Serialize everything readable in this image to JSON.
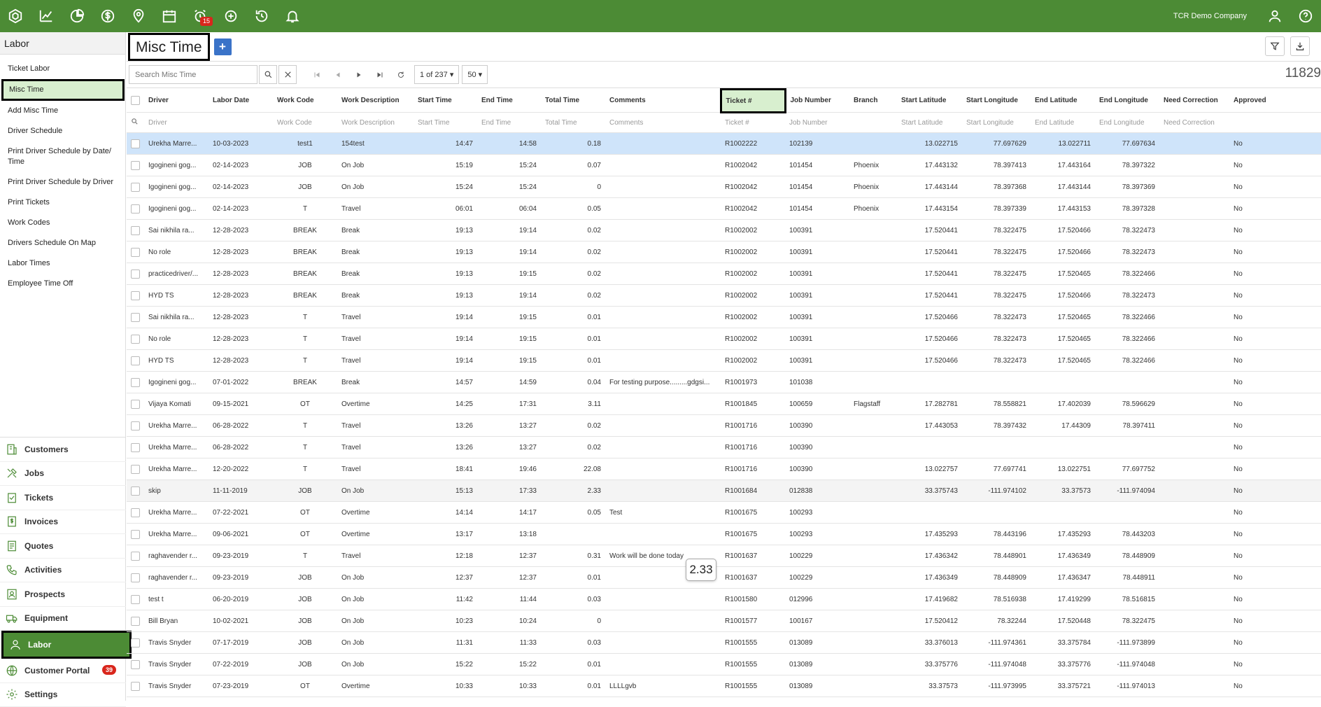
{
  "topbar": {
    "company": "TCR Demo Company",
    "alarm_badge": "15",
    "icons": [
      "logo-icon",
      "analytics-icon",
      "pie-chart-icon",
      "dollar-icon",
      "map-pin-icon",
      "calendar-icon",
      "alarm-clock-icon",
      "add-circle-icon",
      "history-icon",
      "bell-icon"
    ]
  },
  "sidebar": {
    "title": "Labor",
    "items": [
      "Ticket Labor",
      "Misc Time",
      "Add Misc Time",
      "Driver Schedule",
      "Print Driver Schedule by Date/ Time",
      "Print Driver Schedule by Driver",
      "Print Tickets",
      "Work Codes",
      "Drivers Schedule On Map",
      "Labor Times",
      "Employee Time Off"
    ],
    "modules": [
      "Customers",
      "Jobs",
      "Tickets",
      "Invoices",
      "Quotes",
      "Activities",
      "Prospects",
      "Equipment",
      "Labor",
      "Customer Portal",
      "Settings"
    ],
    "portal_badge": "39"
  },
  "page": {
    "title": "Misc Time",
    "add_label": "+",
    "search_placeholder": "Search Misc Time",
    "page_of": "1 of 237 ▾",
    "page_size": "50 ▾",
    "total": "11829",
    "tooltip": "2.33"
  },
  "table": {
    "columns": [
      "Driver",
      "Labor Date",
      "Work Code",
      "Work Description",
      "Start Time",
      "End Time",
      "Total Time",
      "Comments",
      "Ticket #",
      "Job Number",
      "Branch",
      "Start Latitude",
      "Start Longitude",
      "End Latitude",
      "End Longitude",
      "Need Correction",
      "Approved"
    ],
    "filters": [
      "Driver",
      "",
      "Work Code",
      "Work Description",
      "Start Time",
      "End Time",
      "Total Time",
      "Comments",
      "Ticket #",
      "Job Number",
      "",
      "Start Latitude",
      "Start Longitude",
      "End Latitude",
      "End Longitude",
      "Need Correction",
      ""
    ],
    "rows": [
      [
        "Urekha Marre...",
        "10-03-2023",
        "test1",
        "154test",
        "14:47",
        "14:58",
        "0.18",
        "",
        "R1002222",
        "102139",
        "",
        "13.022715",
        "77.697629",
        "13.022711",
        "77.697634",
        "",
        "No"
      ],
      [
        "Igogineni gog...",
        "02-14-2023",
        "JOB",
        "On Job",
        "15:19",
        "15:24",
        "0.07",
        "",
        "R1002042",
        "101454",
        "Phoenix",
        "17.443132",
        "78.397413",
        "17.443164",
        "78.397322",
        "",
        "No"
      ],
      [
        "Igogineni gog...",
        "02-14-2023",
        "JOB",
        "On Job",
        "15:24",
        "15:24",
        "0",
        "",
        "R1002042",
        "101454",
        "Phoenix",
        "17.443144",
        "78.397368",
        "17.443144",
        "78.397369",
        "",
        "No"
      ],
      [
        "Igogineni gog...",
        "02-14-2023",
        "T",
        "Travel",
        "06:01",
        "06:04",
        "0.05",
        "",
        "R1002042",
        "101454",
        "Phoenix",
        "17.443154",
        "78.397339",
        "17.443153",
        "78.397328",
        "",
        "No"
      ],
      [
        "Sai nikhila ra...",
        "12-28-2023",
        "BREAK",
        "Break",
        "19:13",
        "19:14",
        "0.02",
        "",
        "R1002002",
        "100391",
        "",
        "17.520441",
        "78.322475",
        "17.520466",
        "78.322473",
        "",
        "No"
      ],
      [
        "No role",
        "12-28-2023",
        "BREAK",
        "Break",
        "19:13",
        "19:14",
        "0.02",
        "",
        "R1002002",
        "100391",
        "",
        "17.520441",
        "78.322475",
        "17.520466",
        "78.322473",
        "",
        "No"
      ],
      [
        "practicedriver/...",
        "12-28-2023",
        "BREAK",
        "Break",
        "19:13",
        "19:15",
        "0.02",
        "",
        "R1002002",
        "100391",
        "",
        "17.520441",
        "78.322475",
        "17.520465",
        "78.322466",
        "",
        "No"
      ],
      [
        "HYD TS",
        "12-28-2023",
        "BREAK",
        "Break",
        "19:13",
        "19:14",
        "0.02",
        "",
        "R1002002",
        "100391",
        "",
        "17.520441",
        "78.322475",
        "17.520466",
        "78.322473",
        "",
        "No"
      ],
      [
        "Sai nikhila ra...",
        "12-28-2023",
        "T",
        "Travel",
        "19:14",
        "19:15",
        "0.01",
        "",
        "R1002002",
        "100391",
        "",
        "17.520466",
        "78.322473",
        "17.520465",
        "78.322466",
        "",
        "No"
      ],
      [
        "No role",
        "12-28-2023",
        "T",
        "Travel",
        "19:14",
        "19:15",
        "0.01",
        "",
        "R1002002",
        "100391",
        "",
        "17.520466",
        "78.322473",
        "17.520465",
        "78.322466",
        "",
        "No"
      ],
      [
        "HYD TS",
        "12-28-2023",
        "T",
        "Travel",
        "19:14",
        "19:15",
        "0.01",
        "",
        "R1002002",
        "100391",
        "",
        "17.520466",
        "78.322473",
        "17.520465",
        "78.322466",
        "",
        "No"
      ],
      [
        "Igogineni gog...",
        "07-01-2022",
        "BREAK",
        "Break",
        "14:57",
        "14:59",
        "0.04",
        "For testing purpose.........gdgsi...",
        "R1001973",
        "101038",
        "",
        "",
        "",
        "",
        "",
        "",
        "No"
      ],
      [
        "Vijaya Komati",
        "09-15-2021",
        "OT",
        "Overtime",
        "14:25",
        "17:31",
        "3.11",
        "",
        "R1001845",
        "100659",
        "Flagstaff",
        "17.282781",
        "78.558821",
        "17.402039",
        "78.596629",
        "",
        "No"
      ],
      [
        "Urekha Marre...",
        "06-28-2022",
        "T",
        "Travel",
        "13:26",
        "13:27",
        "0.02",
        "",
        "R1001716",
        "100390",
        "",
        "17.443053",
        "78.397432",
        "17.44309",
        "78.397411",
        "",
        "No"
      ],
      [
        "Urekha Marre...",
        "06-28-2022",
        "T",
        "Travel",
        "13:26",
        "13:27",
        "0.02",
        "",
        "R1001716",
        "100390",
        "",
        "",
        "",
        "",
        "",
        "",
        "No"
      ],
      [
        "Urekha Marre...",
        "12-20-2022",
        "T",
        "Travel",
        "18:41",
        "19:46",
        "22.08",
        "",
        "R1001716",
        "100390",
        "",
        "13.022757",
        "77.697741",
        "13.022751",
        "77.697752",
        "",
        "No"
      ],
      [
        "skip",
        "11-11-2019",
        "JOB",
        "On Job",
        "15:13",
        "17:33",
        "2.33",
        "",
        "R1001684",
        "012838",
        "",
        "33.375743",
        "-111.974102",
        "33.37573",
        "-111.974094",
        "",
        "No"
      ],
      [
        "Urekha Marre...",
        "07-22-2021",
        "OT",
        "Overtime",
        "14:14",
        "14:17",
        "0.05",
        "Test",
        "R1001675",
        "100293",
        "",
        "",
        "",
        "",
        "",
        "",
        "No"
      ],
      [
        "Urekha Marre...",
        "09-06-2021",
        "OT",
        "Overtime",
        "13:17",
        "13:18",
        "",
        "",
        "R1001675",
        "100293",
        "",
        "17.435293",
        "78.443196",
        "17.435293",
        "78.443203",
        "",
        "No"
      ],
      [
        "raghavender r...",
        "09-23-2019",
        "T",
        "Travel",
        "12:18",
        "12:37",
        "0.31",
        "Work will be done today",
        "R1001637",
        "100229",
        "",
        "17.436342",
        "78.448901",
        "17.436349",
        "78.448909",
        "",
        "No"
      ],
      [
        "raghavender r...",
        "09-23-2019",
        "JOB",
        "On Job",
        "12:37",
        "12:37",
        "0.01",
        "",
        "R1001637",
        "100229",
        "",
        "17.436349",
        "78.448909",
        "17.436347",
        "78.448911",
        "",
        "No"
      ],
      [
        "test t",
        "06-20-2019",
        "JOB",
        "On Job",
        "11:42",
        "11:44",
        "0.03",
        "",
        "R1001580",
        "012996",
        "",
        "17.419682",
        "78.516938",
        "17.419299",
        "78.516815",
        "",
        "No"
      ],
      [
        "Bill Bryan",
        "10-02-2021",
        "JOB",
        "On Job",
        "10:23",
        "10:24",
        "0",
        "",
        "R1001577",
        "100167",
        "",
        "17.520412",
        "78.32244",
        "17.520448",
        "78.322475",
        "",
        "No"
      ],
      [
        "Travis Snyder",
        "07-17-2019",
        "JOB",
        "On Job",
        "11:31",
        "11:33",
        "0.03",
        "",
        "R1001555",
        "013089",
        "",
        "33.376013",
        "-111.974361",
        "33.375784",
        "-111.973899",
        "",
        "No"
      ],
      [
        "Travis Snyder",
        "07-22-2019",
        "JOB",
        "On Job",
        "15:22",
        "15:22",
        "0.01",
        "",
        "R1001555",
        "013089",
        "",
        "33.375776",
        "-111.974048",
        "33.375776",
        "-111.974048",
        "",
        "No"
      ],
      [
        "Travis Snyder",
        "07-23-2019",
        "OT",
        "Overtime",
        "10:33",
        "10:33",
        "0.01",
        "LLLLgvb",
        "R1001555",
        "013089",
        "",
        "33.37573",
        "-111.973995",
        "33.375721",
        "-111.974013",
        "",
        "No"
      ]
    ]
  }
}
